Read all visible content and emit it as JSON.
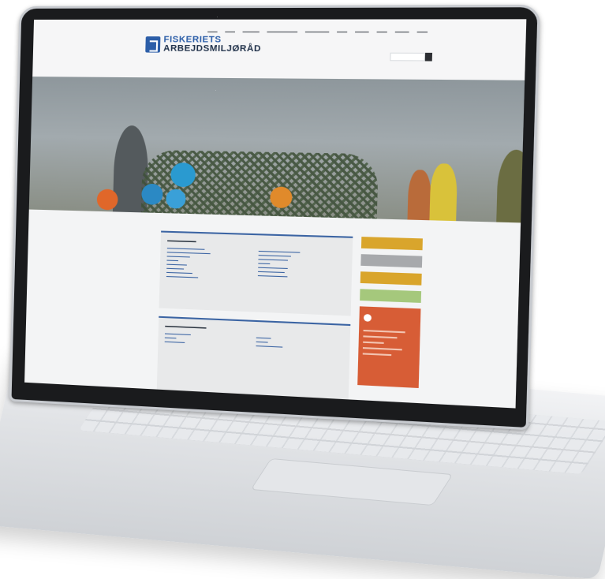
{
  "site": {
    "logo_line1": "FISKERIETS",
    "logo_line2": "ARBEJDSMILJØRÅD"
  },
  "colors": {
    "brand_blue": "#2c5ea8",
    "accent_orange": "#d75d36",
    "button_yellow": "#d9a52c",
    "button_grey": "#a7a9ac",
    "button_green": "#a5c87c"
  },
  "icons": [
    "logo-icon",
    "search-icon",
    "clock-icon"
  ]
}
